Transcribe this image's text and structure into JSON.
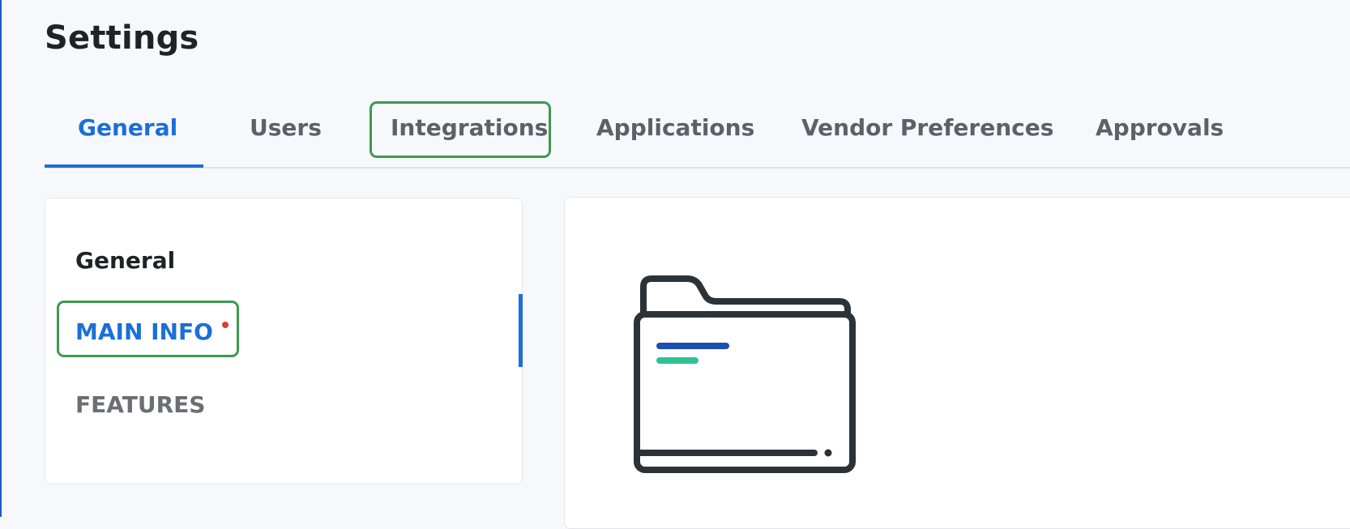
{
  "header": {
    "title": "Settings"
  },
  "tabs": [
    {
      "label": "General",
      "active": true
    },
    {
      "label": "Users",
      "active": false
    },
    {
      "label": "Integrations",
      "active": false
    },
    {
      "label": "Applications",
      "active": false
    },
    {
      "label": "Vendor Preferences",
      "active": false
    },
    {
      "label": "Approvals",
      "active": false
    }
  ],
  "sidebar": {
    "heading": "General",
    "items": [
      {
        "label": "MAIN INFO",
        "active": true,
        "required_indicator": true
      },
      {
        "label": "FEATURES",
        "active": false
      }
    ]
  },
  "content": {
    "illustration": "folder-illustration"
  },
  "colors": {
    "accent": "#1a6fd8",
    "highlight": "#3c9a52",
    "required": "#e03a3a",
    "folder_stroke": "#2b3338",
    "folder_line_blue": "#1b4fb0",
    "folder_line_green": "#2fc193"
  }
}
